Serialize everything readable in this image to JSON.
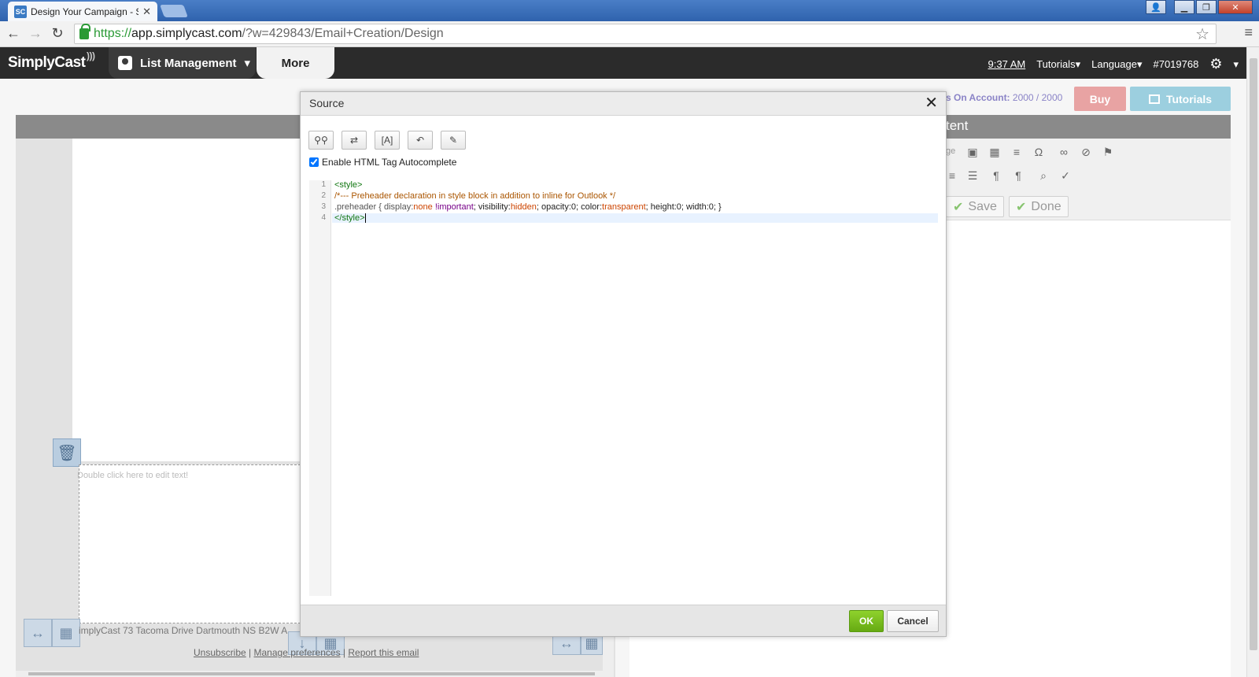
{
  "browser": {
    "tab_title": "Design Your Campaign - S",
    "tab_favicon": "SC",
    "url_https": "https://",
    "url_host": "app.simplycast.com",
    "url_path": "/?w=429843/Email+Creation/Design",
    "icons": [
      "back-icon",
      "forward-icon",
      "reload-icon",
      "lock-icon",
      "star-icon",
      "menu-icon"
    ]
  },
  "app": {
    "logo": "SimplyCast",
    "nav": {
      "list_management": "List Management",
      "more": "More"
    },
    "header_right": {
      "time": "9:37 AM",
      "tutorials": "Tutorials",
      "language": "Language",
      "account": "#7019768"
    }
  },
  "page": {
    "account_label": "s On Account:",
    "account_value": "2000 / 2000",
    "buy": "Buy",
    "tutorials": "Tutorials",
    "content_title": "tent",
    "ck_image_label": "ge",
    "save": "Save",
    "done": "Done",
    "editor_placeholder": "Double click here to edit text!",
    "footer_address": "implyCast 73 Tacoma Drive Dartmouth NS B2W A",
    "footer_links": {
      "unsubscribe": "Unsubscribe",
      "sep1": " | ",
      "manage": "Manage preferences",
      "sep2": " | ",
      "report": "Report this email"
    }
  },
  "dialog": {
    "title": "Source",
    "close": "✕",
    "autocomplete_label": "Enable HTML Tag Autocomplete",
    "autocomplete_checked": true,
    "code": {
      "line1": "<style>",
      "line2": "/*--- Preheader declaration in style block in addition to inline for Outlook */",
      "line3_selector": ".preheader { display:",
      "line3_v1": "none",
      "line3_imp": " !important",
      "line3_p2": "; visibility:",
      "line3_v2": "hidden",
      "line3_p3": "; opacity:0; color:",
      "line3_v3": "transparent",
      "line3_p4": "; height:0; width:0; }",
      "line4": "</style>"
    },
    "line_numbers": [
      "1",
      "2",
      "3",
      "4"
    ],
    "ok": "OK",
    "cancel": "Cancel"
  },
  "colors": {
    "appbar": "#2b2b2b",
    "ok_green": "#78bf1c",
    "buy_pink": "#e8a3a3",
    "tutorials_blue": "#9ccfdf",
    "code_tag": "#117711",
    "code_comment": "#aa5500"
  }
}
